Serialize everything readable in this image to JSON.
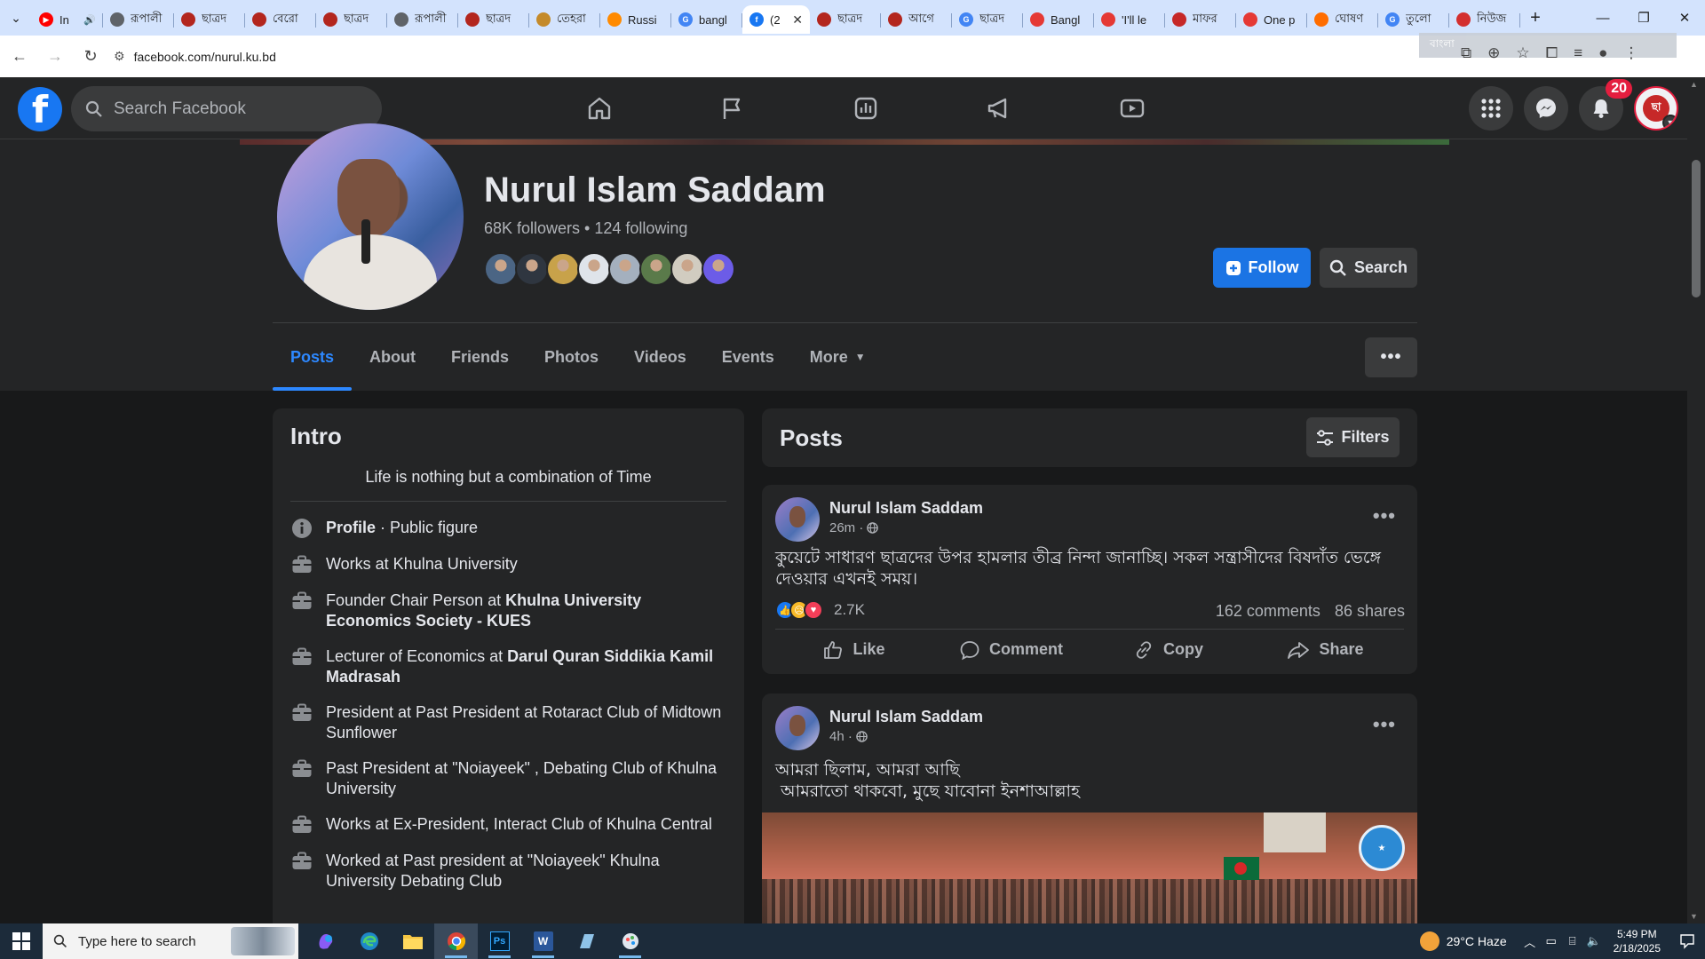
{
  "browser": {
    "tabs": [
      {
        "title": "In",
        "fav_color": "#ff0000",
        "fav_text": "▶"
      },
      {
        "title": "রূপালী",
        "fav_color": "#5f6368",
        "fav_text": ""
      },
      {
        "title": "ছাত্রদ",
        "fav_color": "#b3261e",
        "fav_text": ""
      },
      {
        "title": "বেরো",
        "fav_color": "#b3261e",
        "fav_text": ""
      },
      {
        "title": "ছাত্রদ",
        "fav_color": "#b3261e",
        "fav_text": ""
      },
      {
        "title": "রূপালী",
        "fav_color": "#5f6368",
        "fav_text": ""
      },
      {
        "title": "ছাত্রদ",
        "fav_color": "#b3261e",
        "fav_text": ""
      },
      {
        "title": "তেহরা",
        "fav_color": "#c48a2a",
        "fav_text": ""
      },
      {
        "title": "Russi",
        "fav_color": "#ff8a00",
        "fav_text": ""
      },
      {
        "title": "bangl",
        "fav_color": "#4285f4",
        "fav_text": "G"
      },
      {
        "title": "(2",
        "fav_color": "#1877f2",
        "fav_text": "f"
      },
      {
        "title": "ছাত্রদ",
        "fav_color": "#b3261e",
        "fav_text": ""
      },
      {
        "title": "আগে",
        "fav_color": "#b3261e",
        "fav_text": ""
      },
      {
        "title": "ছাত্রদ",
        "fav_color": "#4285f4",
        "fav_text": "G"
      },
      {
        "title": "Bangl",
        "fav_color": "#e53935",
        "fav_text": ""
      },
      {
        "title": "'I'll le",
        "fav_color": "#e53935",
        "fav_text": ""
      },
      {
        "title": "মাফর",
        "fav_color": "#c62828",
        "fav_text": ""
      },
      {
        "title": "One p",
        "fav_color": "#e53935",
        "fav_text": ""
      },
      {
        "title": "ঘোষণ",
        "fav_color": "#ff6d00",
        "fav_text": ""
      },
      {
        "title": "তুলো",
        "fav_color": "#4285f4",
        "fav_text": "G"
      },
      {
        "title": "নিউজ",
        "fav_color": "#d32f2f",
        "fav_text": ""
      }
    ],
    "url": "facebook.com/nurul.ku.bd",
    "overlay_text": "বাংলা"
  },
  "fb": {
    "search_placeholder": "Search Facebook",
    "notif_count": "20"
  },
  "profile": {
    "name": "Nurul Islam Saddam",
    "followers": "68K followers • 124 following",
    "friend_colors": [
      "#4b6584",
      "#2f3640",
      "#c8a24a",
      "#dfe4ea",
      "#a4b0be",
      "#5a7a4a",
      "#d1ccc0",
      "#6c5ce7"
    ],
    "follow_label": "Follow",
    "search_label": "Search",
    "tabs": [
      "Posts",
      "About",
      "Friends",
      "Photos",
      "Videos",
      "Events",
      "More"
    ]
  },
  "intro": {
    "title": "Intro",
    "bio": "Life is nothing but a combination of Time",
    "profile_label": "Profile",
    "profile_value": " · Public figure",
    "items": [
      {
        "pre": "Works at Khulna University",
        "bold": "",
        "post": ""
      },
      {
        "pre": "Founder Chair Person at ",
        "bold": "Khulna University Economics Society - KUES",
        "post": ""
      },
      {
        "pre": "Lecturer of Economics at ",
        "bold": "Darul Quran Siddikia Kamil Madrasah",
        "post": ""
      },
      {
        "pre": "President at Past President at Rotaract Club of Midtown Sunflower",
        "bold": "",
        "post": ""
      },
      {
        "pre": "Past President at \"Noiayeek\" , Debating Club of Khulna University",
        "bold": "",
        "post": ""
      },
      {
        "pre": "Works at Ex-President, Interact Club of Khulna Central",
        "bold": "",
        "post": ""
      },
      {
        "pre": "Worked at Past president at \"Noiayeek\" Khulna University Debating Club",
        "bold": "",
        "post": ""
      }
    ]
  },
  "posts": {
    "title": "Posts",
    "filters_label": "Filters",
    "list": [
      {
        "author": "Nurul Islam Saddam",
        "time": "26m ·",
        "text": "কুয়েটে সাধারণ ছাত্রদের উপর হামলার তীব্র নিন্দা জানাচ্ছি। সকল সন্ত্রাসীদের বিষদাঁত ভেঙ্গে দেওয়ার এখনই সময়।",
        "reaction_count": "2.7K",
        "comments": "162 comments",
        "shares": "86 shares",
        "actions": [
          "Like",
          "Comment",
          "Copy",
          "Share"
        ]
      },
      {
        "author": "Nurul Islam Saddam",
        "time": "4h ·",
        "text_line1": "আমরা ছিলাম, আমরা আছি",
        "text_line2": " আমরাতো থাকবো, মুছে যাবোনা ইনশাআল্লাহ"
      }
    ]
  },
  "taskbar": {
    "search_placeholder": "Type here to search",
    "weather": "29°C  Haze",
    "time": "5:49 PM",
    "date": "2/18/2025"
  }
}
